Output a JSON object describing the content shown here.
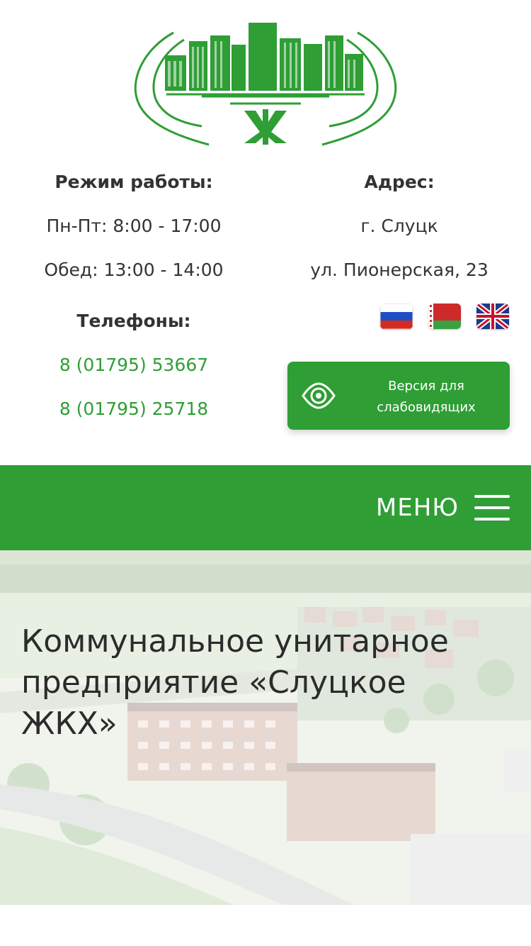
{
  "brand": {
    "logo_mark": "ЖКХ",
    "colors": {
      "primary": "#2f9e35",
      "text": "#333333"
    }
  },
  "contacts": {
    "hours_label": "Режим работы:",
    "weekdays": "Пн-Пт: 8:00 - 17:00",
    "lunch": "Обед: 13:00 - 14:00",
    "phones_label": "Телефоны:",
    "phones": [
      "8 (01795) 53667",
      "8 (01795) 25718"
    ],
    "address_label": "Адрес:",
    "city": "г. Слуцк",
    "street": "ул. Пионерская, 23"
  },
  "languages": [
    {
      "code": "ru",
      "icon": "russia-flag-icon"
    },
    {
      "code": "be",
      "icon": "belarus-flag-icon"
    },
    {
      "code": "en",
      "icon": "uk-flag-icon"
    }
  ],
  "accessibility": {
    "icon": "eye-icon",
    "line1": "Версия для",
    "line2": "слабовидящих"
  },
  "nav": {
    "menu_label": "МЕНЮ",
    "menu_icon": "hamburger-icon"
  },
  "hero": {
    "title": "Коммунальное унитарное предприятие «Слуцкое ЖКХ»"
  }
}
